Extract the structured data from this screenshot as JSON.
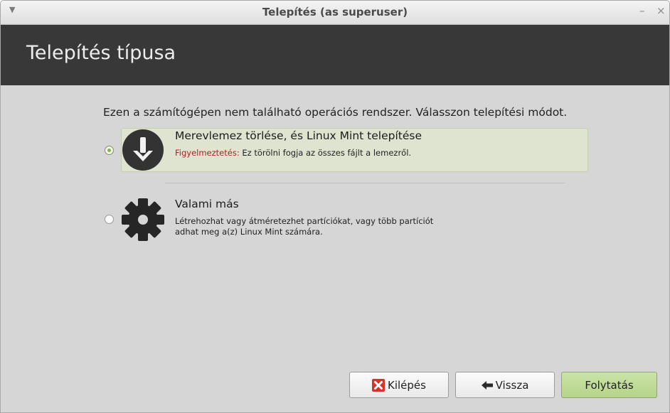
{
  "window": {
    "title": "Telepítés (as superuser)",
    "minimize": "–",
    "close": "×"
  },
  "header": {
    "title": "Telepítés típusa"
  },
  "intro": "Ezen a számítógépen nem található operációs rendszer. Válasszon telepítési módot.",
  "options": [
    {
      "title": "Merevlemez törlése, és Linux Mint telepítése",
      "warning_label": "Figyelmeztetés:",
      "desc": " Ez törölni fogja az összes fájlt a lemezről.",
      "selected": true,
      "icon": "download-arrow-icon"
    },
    {
      "title": "Valami más",
      "desc": "Létrehozhat vagy átméretezhet partíciókat, vagy több partíciót adhat meg a(z) Linux Mint számára.",
      "selected": false,
      "icon": "gear-icon"
    }
  ],
  "buttons": {
    "quit": "Kilépés",
    "back": "Vissza",
    "continue": "Folytatás"
  },
  "colors": {
    "header_bg": "#383838",
    "selected_bg": "#dfe4d1",
    "primary_button": "#b5d48a",
    "warning": "#b02020",
    "quit_icon": "#d9302a"
  }
}
